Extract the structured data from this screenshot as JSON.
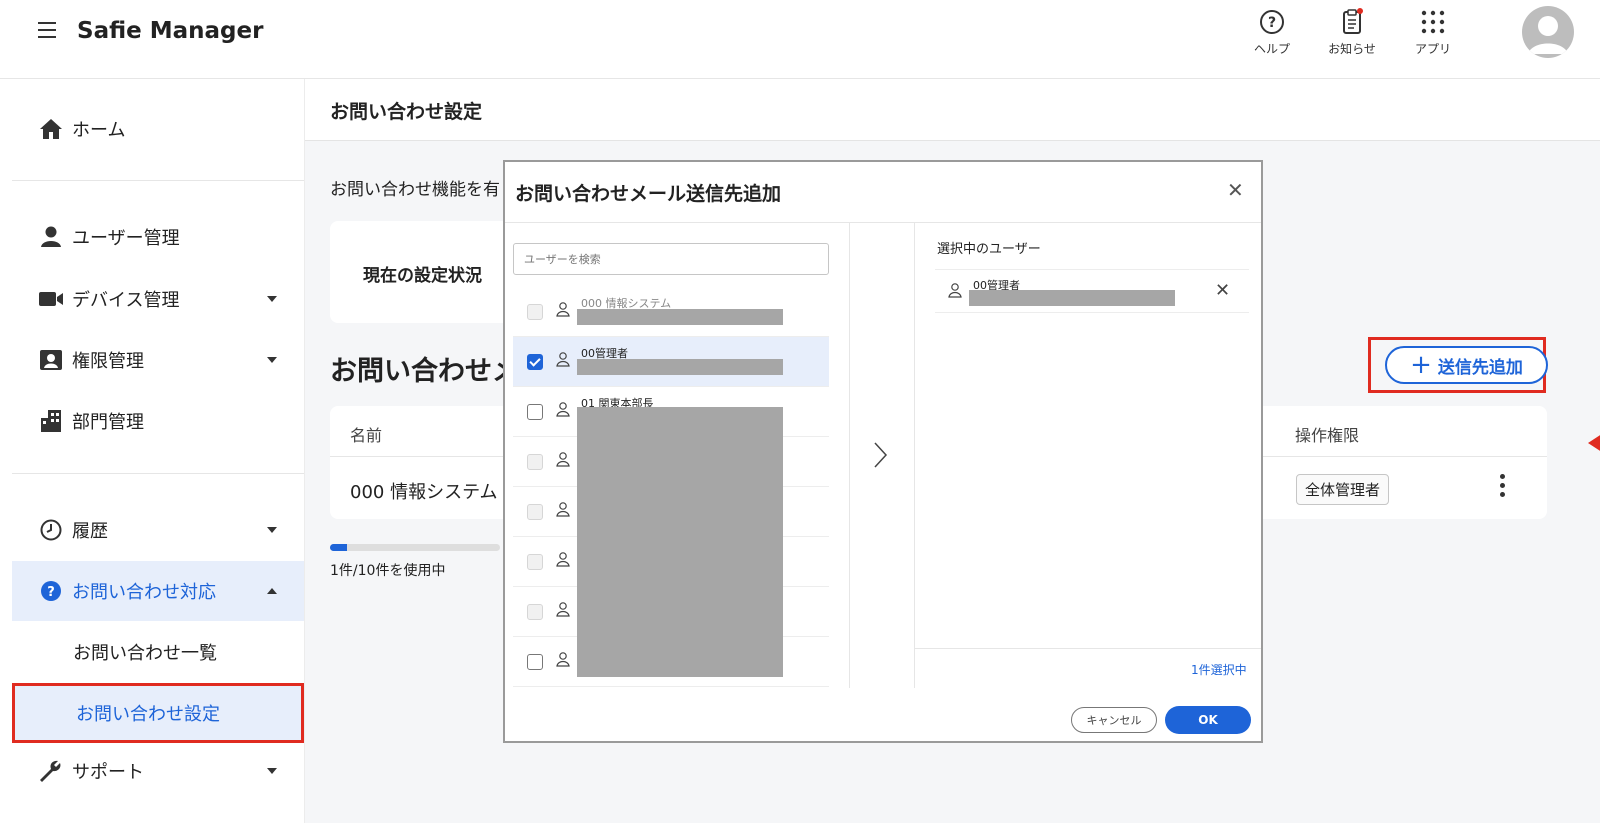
{
  "header": {
    "app_title": "Safie Manager",
    "help_label": "ヘルプ",
    "news_label": "お知らせ",
    "apps_label": "アプリ"
  },
  "sidebar": {
    "items": [
      {
        "label": "ホーム",
        "icon": "home-icon"
      },
      {
        "label": "ユーザー管理",
        "icon": "user-icon"
      },
      {
        "label": "デバイス管理",
        "icon": "camera-icon"
      },
      {
        "label": "権限管理",
        "icon": "id-card-icon"
      },
      {
        "label": "部門管理",
        "icon": "building-icon"
      },
      {
        "label": "履歴",
        "icon": "clock-icon"
      },
      {
        "label": "お問い合わせ対応",
        "icon": "question-icon"
      },
      {
        "label": "お問い合わせ一覧"
      },
      {
        "label": "お問い合わせ設定"
      },
      {
        "label": "サポート",
        "icon": "wrench-icon"
      }
    ]
  },
  "main": {
    "page_title": "お問い合わせ設定",
    "description": "お問い合わせ機能を有",
    "status_label": "現在の設定状況",
    "section_title": "お問い合わせメ",
    "add_button_label": "送信先追加",
    "table": {
      "col_name": "名前",
      "col_permission": "操作権限",
      "row_name": "000 情報システム",
      "row_permission": "全体管理者"
    },
    "usage_text": "1件/10件を使用中",
    "usage_fraction": 0.1
  },
  "modal": {
    "title": "お問い合わせメール送信先追加",
    "search_placeholder": "ユーザーを検索",
    "users": [
      {
        "name": "000 情報システム",
        "state": "disabled"
      },
      {
        "name": "00管理者",
        "state": "checked"
      },
      {
        "name": "01 関東本部長",
        "state": "unchecked"
      },
      {
        "name": "",
        "state": "disabled"
      },
      {
        "name": "",
        "state": "disabled"
      },
      {
        "name": "",
        "state": "disabled"
      },
      {
        "name": "",
        "state": "disabled"
      },
      {
        "name": "",
        "state": "unchecked"
      }
    ],
    "selected_title": "選択中のユーザー",
    "selected_user": "00管理者",
    "selected_count": "1件選択中",
    "cancel_label": "キャンセル",
    "ok_label": "OK"
  },
  "colors": {
    "accent": "#1e64d8",
    "highlight_border": "#e02b20",
    "active_bg": "#e7eefb"
  }
}
